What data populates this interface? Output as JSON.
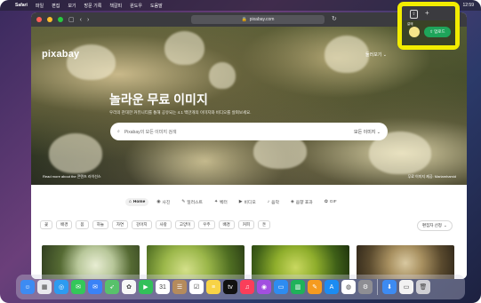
{
  "menubar": {
    "apple": "",
    "app": "Safari",
    "items": [
      "파일",
      "편집",
      "보기",
      "방문 기록",
      "책갈피",
      "윈도우",
      "도움말"
    ],
    "time": "12:59"
  },
  "browser": {
    "url": "pixabay.com",
    "traffic_colors": [
      "#fe5f57",
      "#febc2e",
      "#28c840"
    ]
  },
  "hero": {
    "logo": "pixabay",
    "explore": "둘러보기 ⌄",
    "title": "놀라운 무료 이미지",
    "subtitle": "우리의 관대한 커뮤니티를 통해 공유되는 4.1 백만개의 이미지와 비디오를 살펴보세요.",
    "search_placeholder": "Pixabay의 모든 이미지 검색",
    "search_type": "모든 이미지",
    "credit_left": "Read more about the 콘텐츠 라이선스",
    "credit_right": "무료 이미지 제공: Mariamhamid"
  },
  "categories": [
    {
      "icon": "home-icon",
      "glyph": "⌂",
      "label": "Home",
      "active": true
    },
    {
      "icon": "camera-icon",
      "glyph": "◉",
      "label": "사진",
      "active": false
    },
    {
      "icon": "brush-icon",
      "glyph": "✎",
      "label": "일러스트",
      "active": false
    },
    {
      "icon": "vector-icon",
      "glyph": "✦",
      "label": "벡터",
      "active": false
    },
    {
      "icon": "video-icon",
      "glyph": "▶",
      "label": "비디오",
      "active": false
    },
    {
      "icon": "music-icon",
      "glyph": "♪",
      "label": "음악",
      "active": false
    },
    {
      "icon": "sound-icon",
      "glyph": "◈",
      "label": "음향 효과",
      "active": false
    },
    {
      "icon": "gif-icon",
      "glyph": "✿",
      "label": "GIF",
      "active": false
    }
  ],
  "tags": [
    "꽃",
    "배경",
    "봄",
    "하늘",
    "자연",
    "강아지",
    "사랑",
    "고양이",
    "우주",
    "배경",
    "커피",
    "돈"
  ],
  "sort_label": "편집자 선정",
  "highlight": {
    "name": "갈매",
    "upload": "업로드",
    "share_glyph": "⇪",
    "plus_glyph": "+"
  },
  "dock": [
    {
      "name": "finder-icon",
      "color": "#3d8bf2",
      "glyph": "☺"
    },
    {
      "name": "launchpad-icon",
      "color": "#e9e9ee",
      "glyph": "▦"
    },
    {
      "name": "safari-icon",
      "color": "#2d9bf0",
      "glyph": "◎"
    },
    {
      "name": "messages-icon",
      "color": "#34c759",
      "glyph": "✉"
    },
    {
      "name": "mail-icon",
      "color": "#3a82f7",
      "glyph": "✉"
    },
    {
      "name": "maps-icon",
      "color": "#58c16b",
      "glyph": "➶"
    },
    {
      "name": "photos-icon",
      "color": "#f7f7f7",
      "glyph": "✿"
    },
    {
      "name": "facetime-icon",
      "color": "#32c05a",
      "glyph": "▶"
    },
    {
      "name": "calendar-icon",
      "color": "#ffffff",
      "glyph": "31"
    },
    {
      "name": "contacts-icon",
      "color": "#b58b5c",
      "glyph": "☰"
    },
    {
      "name": "reminders-icon",
      "color": "#ffffff",
      "glyph": "☑"
    },
    {
      "name": "notes-icon",
      "color": "#f7d346",
      "glyph": "≡"
    },
    {
      "name": "tv-icon",
      "color": "#111111",
      "glyph": "tv"
    },
    {
      "name": "music-app-icon",
      "color": "#fa3e5a",
      "glyph": "♫"
    },
    {
      "name": "podcasts-icon",
      "color": "#a24fe0",
      "glyph": "◉"
    },
    {
      "name": "keynote-icon",
      "color": "#2e8cf0",
      "glyph": "▭"
    },
    {
      "name": "numbers-icon",
      "color": "#1fb25a",
      "glyph": "▥"
    },
    {
      "name": "pages-icon",
      "color": "#f59b1f",
      "glyph": "✎"
    },
    {
      "name": "app-store-icon",
      "color": "#1c8cf2",
      "glyph": "A"
    },
    {
      "name": "chrome-icon",
      "color": "#ffffff",
      "glyph": "◍"
    },
    {
      "name": "settings-icon",
      "color": "#8e8e93",
      "glyph": "⚙"
    },
    {
      "name": "downloads-icon",
      "color": "#3d8bf2",
      "glyph": "⬇"
    },
    {
      "name": "window-thumb-icon",
      "color": "#f2f2f2",
      "glyph": "▭"
    },
    {
      "name": "trash-icon",
      "color": "#cfcfd4",
      "glyph": "🗑"
    }
  ]
}
